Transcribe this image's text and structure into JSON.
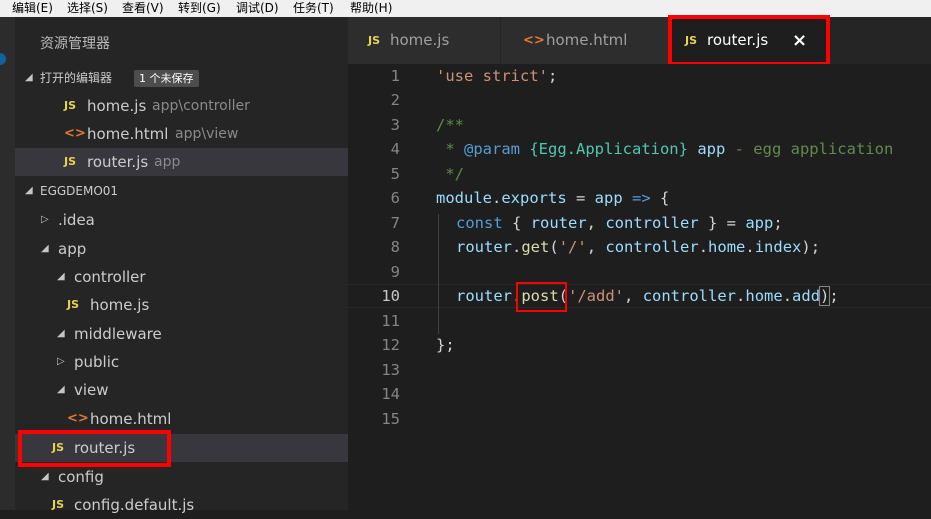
{
  "menu": {
    "items": [
      "编辑(E)",
      "选择(S)",
      "查看(V)",
      "转到(G)",
      "调试(D)",
      "任务(T)",
      "帮助(H)"
    ]
  },
  "sidebar": {
    "title": "资源管理器",
    "open_editors": {
      "label": "打开的编辑器",
      "badge": "1 个未保存",
      "items": [
        {
          "icon": "js-file-icon",
          "name": "home.js",
          "path": "app\\controller"
        },
        {
          "icon": "html-file-icon",
          "name": "home.html",
          "path": "app\\view"
        },
        {
          "icon": "js-file-icon",
          "name": "router.js",
          "path": "app"
        }
      ]
    },
    "project": {
      "label": "EGGDEMO01",
      "tree": [
        {
          "name": ".idea",
          "type": "folder",
          "expanded": false
        },
        {
          "name": "app",
          "type": "folder",
          "expanded": true
        },
        {
          "name": "controller",
          "type": "folder",
          "expanded": true
        },
        {
          "name": "home.js",
          "type": "js"
        },
        {
          "name": "middleware",
          "type": "folder",
          "expanded": true
        },
        {
          "name": "public",
          "type": "folder",
          "expanded": false
        },
        {
          "name": "view",
          "type": "folder",
          "expanded": true
        },
        {
          "name": "home.html",
          "type": "html"
        },
        {
          "name": "router.js",
          "type": "js"
        },
        {
          "name": "config",
          "type": "folder",
          "expanded": true
        },
        {
          "name": "config.default.js",
          "type": "js"
        }
      ]
    }
  },
  "tabs": [
    {
      "icon": "JS",
      "label": "home.js",
      "active": false
    },
    {
      "icon": "<>",
      "label": "home.html",
      "active": false
    },
    {
      "icon": "JS",
      "label": "router.js",
      "active": true,
      "close": "×"
    }
  ],
  "editor": {
    "current_line": 10,
    "lines": [
      "1",
      "2",
      "3",
      "4",
      "5",
      "6",
      "7",
      "8",
      "9",
      "10",
      "11",
      "12",
      "13",
      "14",
      "15"
    ],
    "code": {
      "l1_str": "'use strict'",
      "l1_end": ";",
      "l3": "/**",
      "l4_star": " * ",
      "l4_tag": "@param",
      "l4_type": " {Egg.Application} ",
      "l4_name": "app",
      "l4_desc": " - egg application",
      "l5": " */",
      "l6_a": "module",
      "l6_b": ".",
      "l6_c": "exports",
      "l6_d": " = ",
      "l6_e": "app",
      "l6_f": " => ",
      "l6_g": "{",
      "l7_kw": "const",
      "l7_a": " { ",
      "l7_b": "router",
      "l7_c": ", ",
      "l7_d": "controller",
      "l7_e": " } = ",
      "l7_f": "app",
      "l7_g": ";",
      "l8_a": "router",
      "l8_b": ".",
      "l8_c": "get",
      "l8_d": "(",
      "l8_e": "'/'",
      "l8_f": ", ",
      "l8_g": "controller",
      "l8_h": ".",
      "l8_i": "home",
      "l8_j": ".",
      "l8_k": "index",
      "l8_l": ");",
      "l10_a": "router",
      "l10_b": ".",
      "l10_c": "post",
      "l10_d": "(",
      "l10_e": "'/add'",
      "l10_f": ", ",
      "l10_g": "controller",
      "l10_h": ".",
      "l10_i": "home",
      "l10_j": ".",
      "l10_k": "add",
      "l10_l": ")",
      "l10_m": ";",
      "l12": "};"
    }
  },
  "colors": {
    "highlight_box": "#ff0000",
    "js_icon": "#e8d44d",
    "html_icon": "#e37933"
  }
}
